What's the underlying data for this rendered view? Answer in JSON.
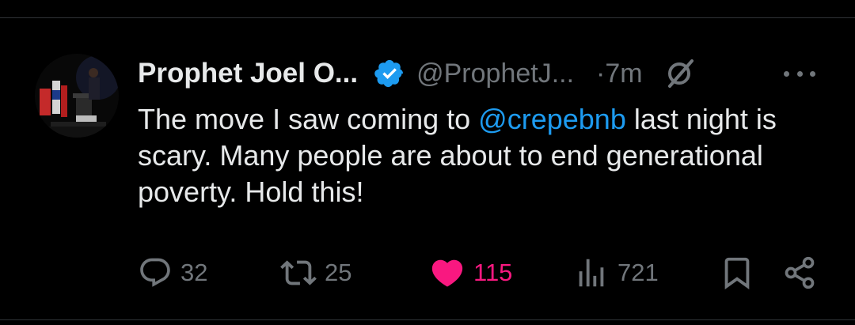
{
  "tweet": {
    "author_name": "Prophet Joel O...",
    "handle": "@ProphetJ...",
    "separator": "·",
    "time": "7m",
    "body": {
      "text_before": "The move I saw coming to ",
      "mention": "@crepebnb",
      "text_after": " last night is scary. Many people are about to end generational poverty. Hold this!"
    },
    "actions": {
      "replies": "32",
      "retweets": "25",
      "likes": "115",
      "views": "721"
    }
  },
  "colors": {
    "background": "#000000",
    "text": "#e7e9ea",
    "muted": "#71767b",
    "accent": "#1d9bf0",
    "like": "#f91880"
  },
  "icons": [
    "verified-badge-icon",
    "grok-icon",
    "more-icon",
    "reply-icon",
    "retweet-icon",
    "like-icon",
    "views-icon",
    "bookmark-icon",
    "share-icon"
  ]
}
